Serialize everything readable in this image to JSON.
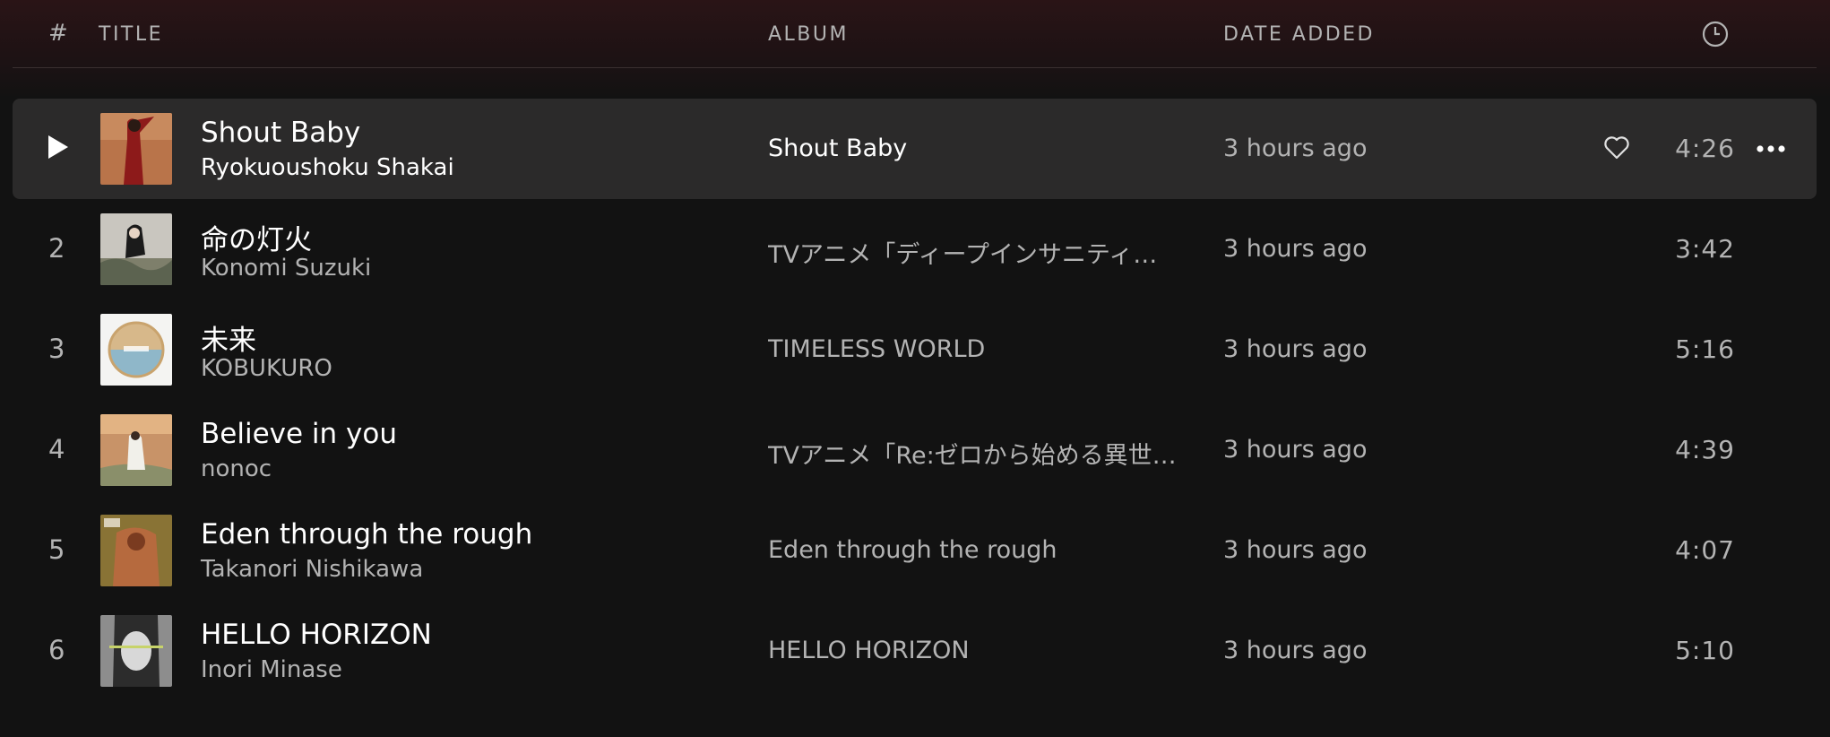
{
  "columns": {
    "number": "#",
    "title": "TITLE",
    "album": "ALBUM",
    "date_added": "DATE ADDED",
    "duration_icon": "clock-icon"
  },
  "tracks": [
    {
      "number": "1",
      "title": "Shout Baby",
      "artist": "Ryokuoushoku Shakai",
      "album": "Shout Baby",
      "date_added": "3 hours ago",
      "duration": "4:26",
      "selected": true
    },
    {
      "number": "2",
      "title": "命の灯火",
      "artist": "Konomi Suzuki",
      "album": "TVアニメ「ディープインサニティ…",
      "date_added": "3 hours ago",
      "duration": "3:42"
    },
    {
      "number": "3",
      "title": "未来",
      "artist": "KOBUKURO",
      "album": "TIMELESS WORLD",
      "date_added": "3 hours ago",
      "duration": "5:16"
    },
    {
      "number": "4",
      "title": "Believe in you",
      "artist": "nonoc",
      "album": "TVアニメ「Re:ゼロから始める異世…",
      "date_added": "3 hours ago",
      "duration": "4:39"
    },
    {
      "number": "5",
      "title": "Eden through the rough",
      "artist": "Takanori Nishikawa",
      "album": "Eden through the rough",
      "date_added": "3 hours ago",
      "duration": "4:07"
    },
    {
      "number": "6",
      "title": "HELLO HORIZON",
      "artist": "Inori Minase",
      "album": "HELLO HORIZON",
      "date_added": "3 hours ago",
      "duration": "5:10"
    }
  ],
  "icons": {
    "play": "play-icon",
    "like": "heart-icon",
    "more": "more-options-icon"
  },
  "colors": {
    "background": "#121212",
    "header_tint": "#2a1416",
    "selected_row": "#2b2a2a",
    "primary_text": "#ffffff",
    "secondary_text": "#b3b3b3"
  }
}
